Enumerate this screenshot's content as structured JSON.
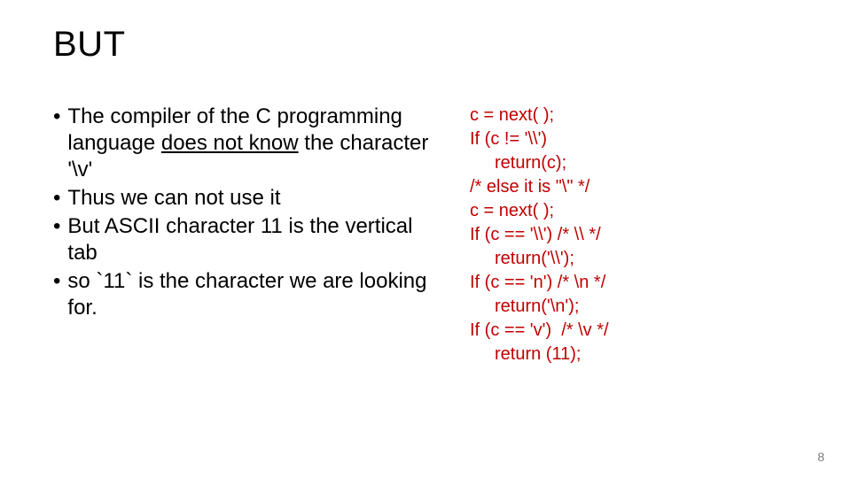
{
  "title": "BUT",
  "bullets": [
    {
      "pre": "The  compiler of the C programming language ",
      "underlined": "does not know",
      "post": " the character '\\v'"
    },
    {
      "pre": "Thus we can not use it",
      "underlined": "",
      "post": ""
    },
    {
      "pre": "But ASCII character 11 is the vertical tab",
      "underlined": "",
      "post": ""
    },
    {
      "pre": "so `11` is the character we are looking for.",
      "underlined": "",
      "post": ""
    }
  ],
  "code": [
    {
      "text": "c = next( );",
      "indent": false
    },
    {
      "text": "If (c != '\\\\')",
      "indent": false
    },
    {
      "text": "return(c);",
      "indent": true
    },
    {
      "text": "/* else it is \"\\\" */",
      "indent": false
    },
    {
      "text": "c = next( );",
      "indent": false
    },
    {
      "text": "If (c == '\\\\') /* \\\\ */",
      "indent": false
    },
    {
      "text": "return('\\\\');",
      "indent": true
    },
    {
      "text": "If (c == 'n') /* \\n */",
      "indent": false
    },
    {
      "text": "return('\\n');",
      "indent": true
    },
    {
      "text": "If (c == 'v')  /* \\v */",
      "indent": false
    },
    {
      "text": "return (11);",
      "indent": true
    }
  ],
  "page_number": "8"
}
